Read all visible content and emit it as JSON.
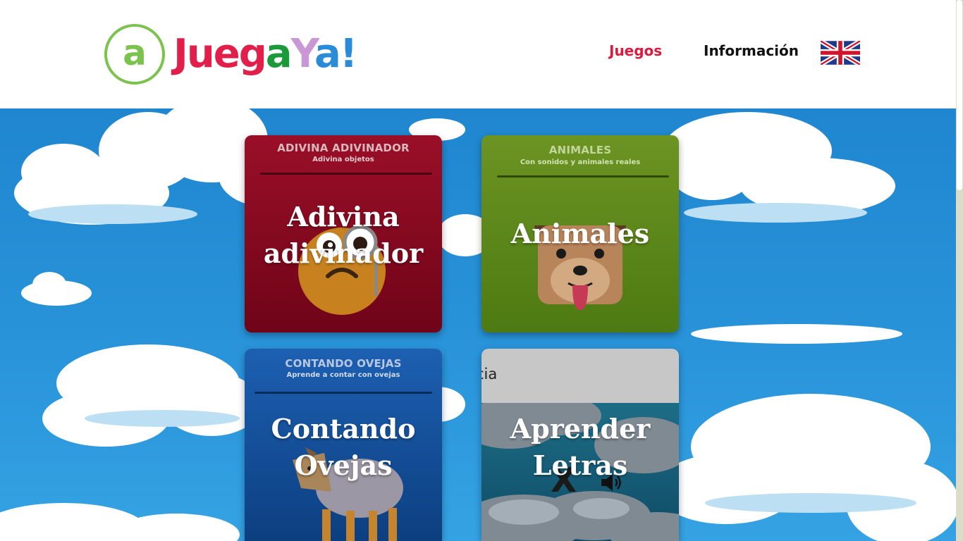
{
  "header": {
    "logo_mark": "a",
    "logo_parts": [
      "J",
      "ueg",
      "a",
      "Y",
      "a!"
    ],
    "nav": {
      "juegos": "Juegos",
      "informacion": "Información"
    },
    "language_flag_icon": "uk-flag-icon"
  },
  "cards": [
    {
      "small_title": "ADIVINA ADIVINADOR",
      "subtitle": "Adivina objetos",
      "big_title_line1": "Adivina",
      "big_title_line2": "adivinador",
      "icon": "monocle-face-icon",
      "color": "#8a0a22"
    },
    {
      "small_title": "ANIMALES",
      "subtitle": "Con sonidos y animales reales",
      "big_title_line1": "Animales",
      "icon": "dog-face-icon",
      "color": "#5f8a1a"
    },
    {
      "small_title": "CONTANDO OVEJAS",
      "subtitle": "Aprende a contar con ovejas",
      "big_title_line1": "Contando",
      "big_title_line2": "Ovejas",
      "icon": "sheep-icon",
      "color": "#1556a3"
    },
    {
      "preview_text": "cia",
      "big_title_line1": "Aprender",
      "big_title_line2": "Letras",
      "letter": "X",
      "icon": "speaker-icon",
      "color": "#c7c7c7"
    }
  ],
  "colors": {
    "brand_red": "#d81b3f",
    "brand_green": "#7cc24e",
    "sky": "#2a95db"
  }
}
